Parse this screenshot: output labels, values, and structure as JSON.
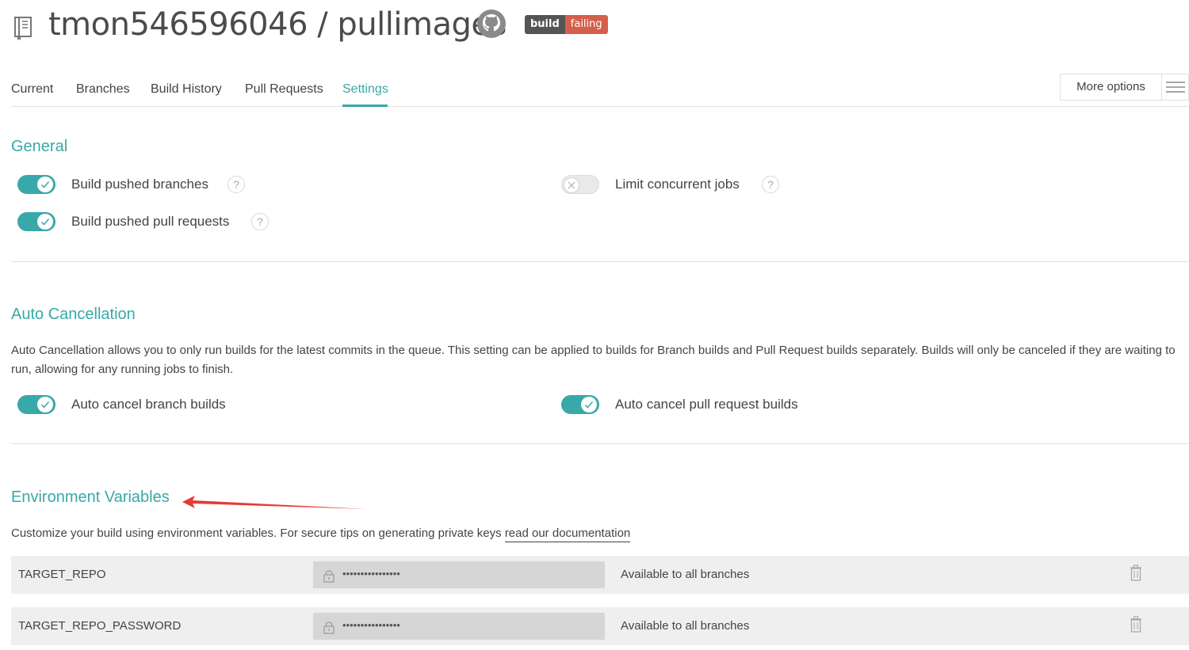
{
  "header": {
    "repo_title": "tmon546596046 / pullimages",
    "badge_left": "build",
    "badge_right": "failing"
  },
  "tabs": [
    {
      "label": "Current"
    },
    {
      "label": "Branches"
    },
    {
      "label": "Build History"
    },
    {
      "label": "Pull Requests"
    },
    {
      "label": "Settings",
      "active": true
    }
  ],
  "more_options_label": "More options",
  "general": {
    "title": "General",
    "options": [
      {
        "label": "Build pushed branches",
        "enabled": true
      },
      {
        "label": "Build pushed pull requests",
        "enabled": true
      },
      {
        "label": "Limit concurrent jobs",
        "enabled": false
      }
    ]
  },
  "auto_cancellation": {
    "title": "Auto Cancellation",
    "description": "Auto Cancellation allows you to only run builds for the latest commits in the queue. This setting can be applied to builds for Branch builds and Pull Request builds separately. Builds will only be canceled if they are waiting to run, allowing for any running jobs to finish.",
    "options": [
      {
        "label": "Auto cancel branch builds",
        "enabled": true
      },
      {
        "label": "Auto cancel pull request builds",
        "enabled": true
      }
    ]
  },
  "env": {
    "title": "Environment Variables",
    "description": "Customize your build using environment variables. For secure tips on generating private keys ",
    "link_text": "read our documentation",
    "rows": [
      {
        "name": "TARGET_REPO",
        "value": "••••••••••••••••",
        "scope": "Available to all branches"
      },
      {
        "name": "TARGET_REPO_PASSWORD",
        "value": "••••••••••••••••",
        "scope": "Available to all branches"
      }
    ]
  },
  "colors": {
    "accent": "#39a8a8",
    "badge_fail": "#d45f4d",
    "annotation_arrow": "#e53935"
  },
  "icons": [
    "repo-icon",
    "github-icon",
    "hamburger-icon",
    "checkmark-icon",
    "x-icon",
    "help-icon",
    "lock-icon",
    "trash-icon",
    "annotation-arrow"
  ]
}
